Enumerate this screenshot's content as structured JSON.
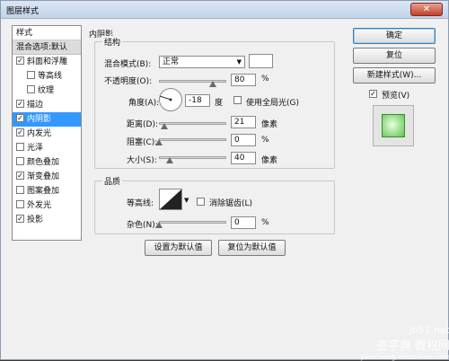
{
  "window": {
    "title": "图层样式",
    "close_glyph": "✕"
  },
  "left_panel": {
    "header": "样式",
    "blend_defaults": "混合选项:默认",
    "items": [
      {
        "label": "斜面和浮雕",
        "checked": true,
        "sub": false,
        "selected": false
      },
      {
        "label": "等高线",
        "checked": false,
        "sub": true,
        "selected": false
      },
      {
        "label": "纹理",
        "checked": false,
        "sub": true,
        "selected": false
      },
      {
        "label": "描边",
        "checked": true,
        "sub": false,
        "selected": false
      },
      {
        "label": "内阴影",
        "checked": true,
        "sub": false,
        "selected": true
      },
      {
        "label": "内发光",
        "checked": true,
        "sub": false,
        "selected": false
      },
      {
        "label": "光泽",
        "checked": false,
        "sub": false,
        "selected": false
      },
      {
        "label": "颜色叠加",
        "checked": false,
        "sub": false,
        "selected": false
      },
      {
        "label": "渐变叠加",
        "checked": true,
        "sub": false,
        "selected": false
      },
      {
        "label": "图案叠加",
        "checked": false,
        "sub": false,
        "selected": false
      },
      {
        "label": "外发光",
        "checked": false,
        "sub": false,
        "selected": false
      },
      {
        "label": "投影",
        "checked": true,
        "sub": false,
        "selected": false
      }
    ]
  },
  "inner_shadow": {
    "section_title": "内阴影",
    "structure_title": "结构",
    "blend_mode_label": "混合模式(B):",
    "blend_mode_value": "正常",
    "opacity_label": "不透明度(O):",
    "opacity_value": "80",
    "opacity_unit": "%",
    "opacity_fraction": 0.8,
    "angle_label": "角度(A):",
    "angle_value": "-18",
    "angle_unit": "度",
    "global_light_label": "使用全局光(G)",
    "distance_label": "距离(D):",
    "distance_value": "21",
    "distance_unit": "像素",
    "distance_fraction": 0.08,
    "choke_label": "阻塞(C):",
    "choke_value": "0",
    "choke_unit": "%",
    "choke_fraction": 0.0,
    "size_label": "大小(S):",
    "size_value": "40",
    "size_unit": "像素",
    "size_fraction": 0.16,
    "quality_title": "品质",
    "contour_label": "等高线:",
    "antialias_label": "消除锯齿(L)",
    "noise_label": "杂色(N):",
    "noise_value": "0",
    "noise_unit": "%",
    "noise_fraction": 0.0,
    "make_default": "设置为默认值",
    "reset_default": "复位为默认值"
  },
  "right_panel": {
    "ok": "确定",
    "reset": "复位",
    "new_style": "新建样式(W)...",
    "preview_label": "预览(V)",
    "preview_checked": true
  },
  "watermark": {
    "site": "jb51.net",
    "brand": "查字典 教程网",
    "url": "jiaocheng.chazidian.com"
  }
}
